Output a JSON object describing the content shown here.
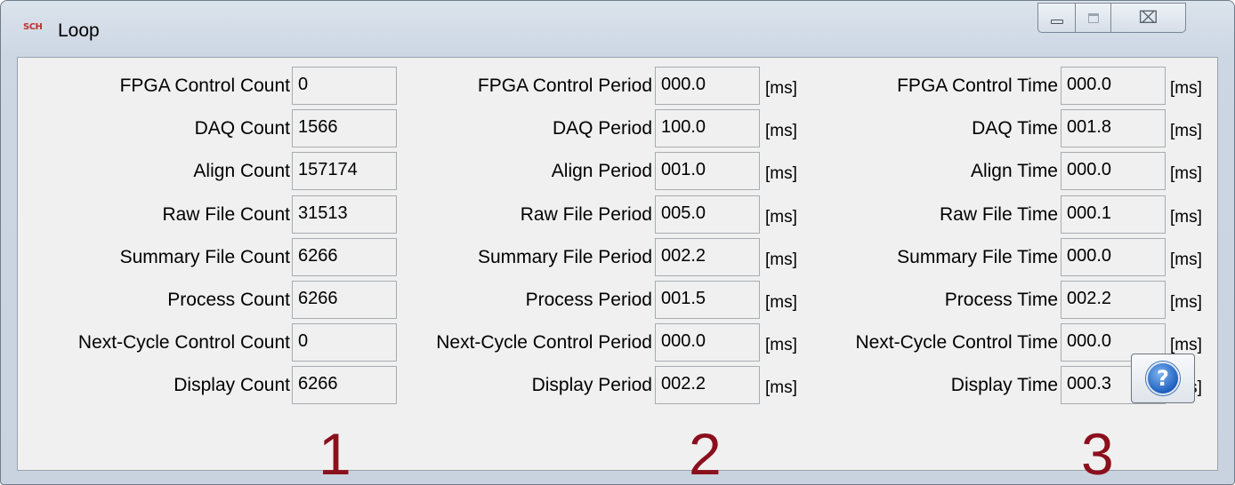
{
  "window": {
    "title": "Loop",
    "app_icon_text": "SCH",
    "minimize_icon": "minimize-icon",
    "maximize_icon": "maximize-icon",
    "close_glyph": "⌧"
  },
  "unit": "[ms]",
  "columns": [
    {
      "marker": "1",
      "rows": [
        {
          "label": "FPGA Control Count",
          "value": "0"
        },
        {
          "label": "DAQ Count",
          "value": "1566"
        },
        {
          "label": "Align Count",
          "value": "157174"
        },
        {
          "label": "Raw File Count",
          "value": "31513"
        },
        {
          "label": "Summary File Count",
          "value": "6266"
        },
        {
          "label": "Process Count",
          "value": "6266"
        },
        {
          "label": "Next-Cycle Control Count",
          "value": "0"
        },
        {
          "label": "Display Count",
          "value": "6266"
        }
      ]
    },
    {
      "marker": "2",
      "rows": [
        {
          "label": "FPGA Control Period",
          "value": "000.0"
        },
        {
          "label": "DAQ Period",
          "value": "100.0"
        },
        {
          "label": "Align Period",
          "value": "001.0"
        },
        {
          "label": "Raw File Period",
          "value": "005.0"
        },
        {
          "label": "Summary File Period",
          "value": "002.2"
        },
        {
          "label": "Process Period",
          "value": "001.5"
        },
        {
          "label": "Next-Cycle Control Period",
          "value": "000.0"
        },
        {
          "label": "Display Period",
          "value": "002.2"
        }
      ]
    },
    {
      "marker": "3",
      "rows": [
        {
          "label": "FPGA Control Time",
          "value": "000.0"
        },
        {
          "label": "DAQ Time",
          "value": "001.8"
        },
        {
          "label": "Align Time",
          "value": "000.0"
        },
        {
          "label": "Raw File Time",
          "value": "000.1"
        },
        {
          "label": "Summary File Time",
          "value": "000.0"
        },
        {
          "label": "Process Time",
          "value": "002.2"
        },
        {
          "label": "Next-Cycle Control Time",
          "value": "000.0"
        },
        {
          "label": "Display Time",
          "value": "000.3"
        }
      ]
    }
  ],
  "help_button": {
    "glyph": "?",
    "icon": "help-icon"
  }
}
